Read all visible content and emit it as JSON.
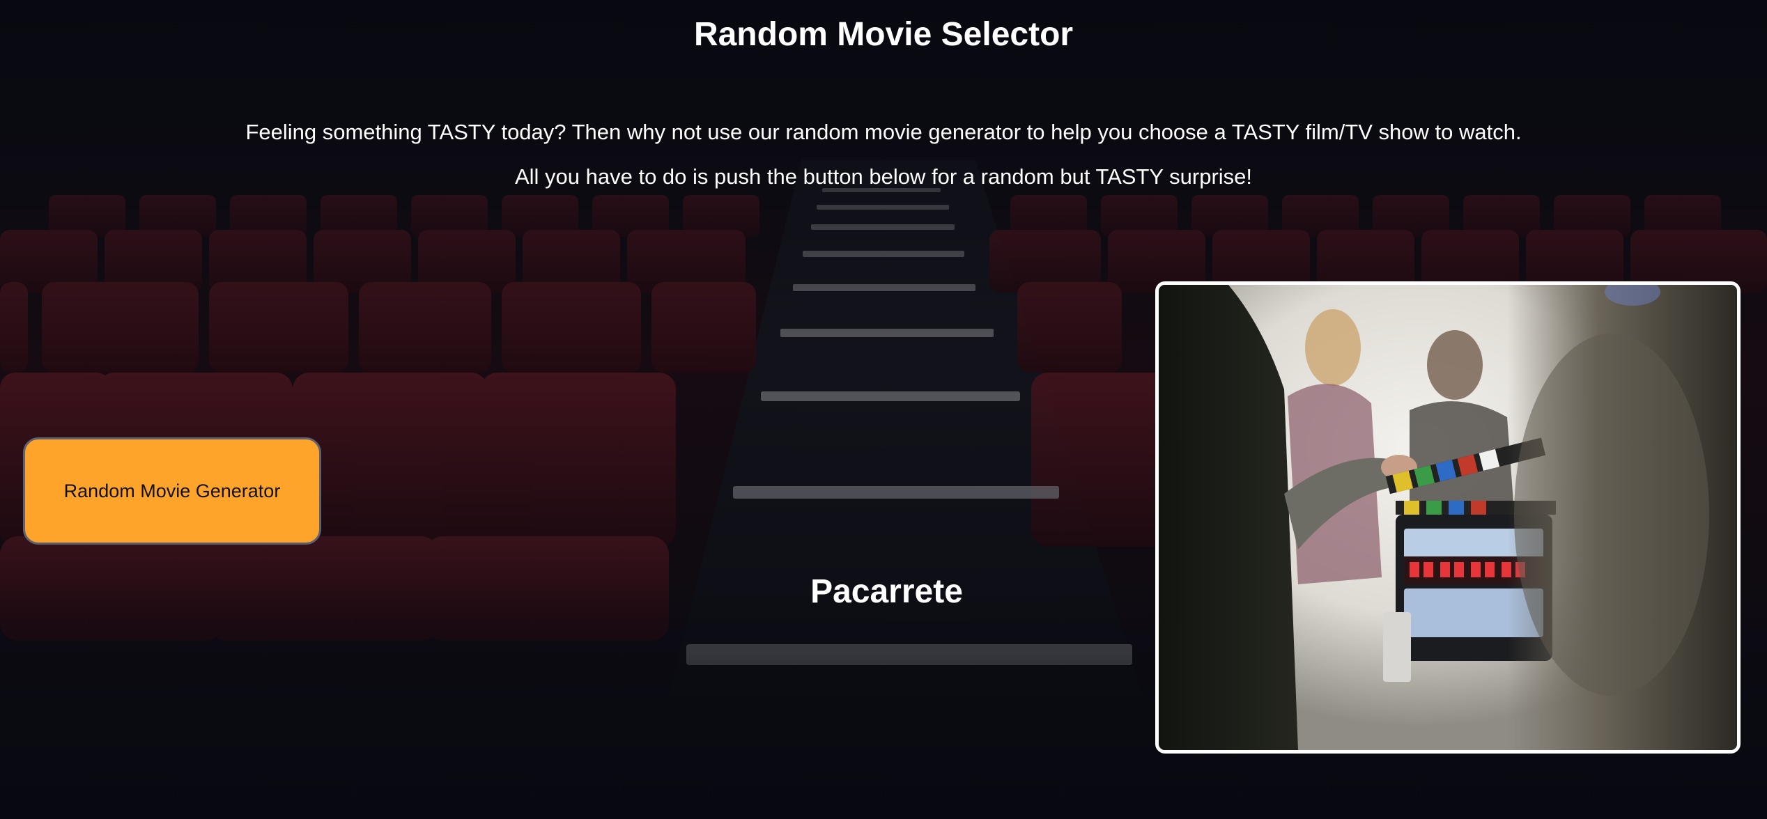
{
  "page": {
    "title": "Random Movie Selector",
    "intro_line_1": "Feeling something TASTY today? Then why not use our random movie generator to help you choose a TASTY film/TV show to watch.",
    "intro_line_2": "All you have to do is push the button below for a random but TASTY surprise!"
  },
  "generator": {
    "button_label": "Random Movie Generator"
  },
  "result": {
    "movie_title": "Pacarrete"
  },
  "colors": {
    "accent": "#ffa42b",
    "background": "#0a0b12",
    "text": "#ffffff"
  }
}
